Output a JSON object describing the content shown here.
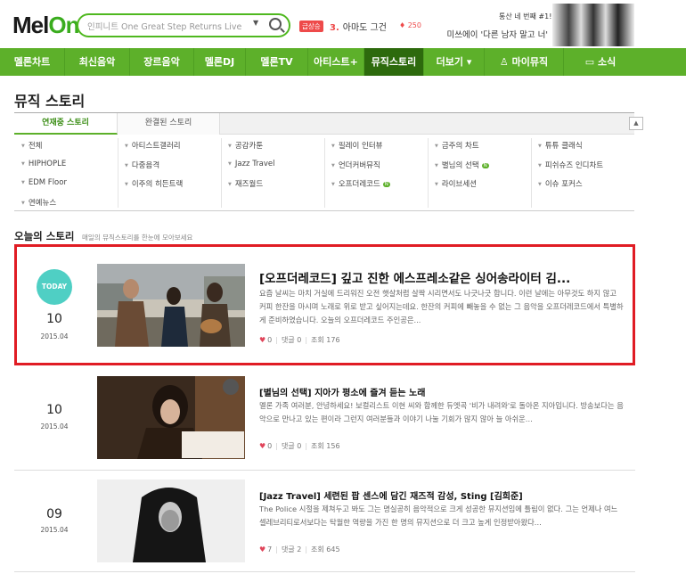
{
  "header": {
    "logo": {
      "mel": "Mel",
      "on": "On"
    },
    "search_placeholder": "인피니트 One Great Step Returns Live 공개!",
    "rising_badge": "급상승",
    "rising_rank": "3.",
    "rising_title": "아마도 그건",
    "rising_count": "250",
    "ad_line1": "통산 네 번째 #1!",
    "ad_line2": "미쓰에이 '다른 남자 말고 너'"
  },
  "nav": [
    "멜론차트",
    "최신음악",
    "장르음악",
    "멜론DJ",
    "멜론TV",
    "아티스트+",
    "뮤직스토리",
    "더보기 ▾",
    "마이뮤직",
    "소식"
  ],
  "page_title": "뮤직 스토리",
  "tabs": {
    "active": "연재중 스토리",
    "inactive": "완결된 스토리"
  },
  "categories": [
    [
      "전체",
      "아티스트갤러리",
      "공감카툰",
      "필레이 인터뷰",
      "금주의 차트",
      "튜튜 클래식"
    ],
    [
      "HIPHOPLE",
      "다중음격",
      "Jazz Travel",
      "언더커버뮤직",
      "별님의 선택",
      "피쉬슈즈 인디차트"
    ],
    [
      "EDM Floor",
      "이주의 히든트랙",
      "재즈월드",
      "오프더레코드",
      "라이브세션",
      "이슈 포커스"
    ],
    [
      "연예뉴스"
    ]
  ],
  "new_label": "N",
  "today_section": {
    "title": "오늘의 스토리",
    "subtitle": "매일의 뮤직스토리를 한눈에 모아보세요"
  },
  "stories": [
    {
      "badge": "TODAY",
      "day": "10",
      "ym": "2015.04",
      "title": "[오프더레코드] 깊고 진한 에스프레소같은 싱어송라이터 김...",
      "desc": "요즘 날씨는 마치 거실에 드리워진 오전 햇살처럼 살짝 시리면서도 나긋나긋 합니다. 이런 날에는 아무것도 하지 않고 커피 한잔을 마시며 노래로 위로 받고 싶어지는데요. 한잔의 커피에 빼놓을 수 없는 그 음악을 오프더레코드에서 특별하게 준비하였습니다. 오늘의 오프더레코드 주인공은...",
      "likes": "0",
      "comments": "댓글 0",
      "views": "조회 176"
    },
    {
      "day": "10",
      "ym": "2015.04",
      "title": "[별님의 선택] 지아가 평소에 즐겨 듣는 노래",
      "desc": "멜론 가족 여러분, 안녕하세요! 보컬리스트 이현 씨와 함께한 듀엣곡 '비가 내려와'로 돌아온 지아입니다. 방송보다는 음악으로 만나고 있는 편이라 그런지 여러분들과 이야기 나눌 기회가 많지 않아 늘 아쉬운...",
      "likes": "0",
      "comments": "댓글 0",
      "views": "조회 156"
    },
    {
      "day": "09",
      "ym": "2015.04",
      "title": "[Jazz Travel] 세련된 팝 센스에 담긴 재즈적 감성, Sting [김희준]",
      "desc": "The Police 시절을 제쳐두고 봐도 그는 명실공히 음악적으로 크게 성공한 뮤지션임에 틀림이 없다. 그는 언제나 여느 셀레브리티로서보다는 탁월한 역량을 가진 한 명의 뮤지션으로 더 크고 높게 인정받아왔다...",
      "likes": "7",
      "comments": "댓글 2",
      "views": "조회 645"
    }
  ],
  "colors": {
    "brand_green": "#5db02a",
    "nav_active": "#2d6a0d",
    "highlight_border": "#e01c24",
    "today_badge": "#4fcfc4"
  }
}
